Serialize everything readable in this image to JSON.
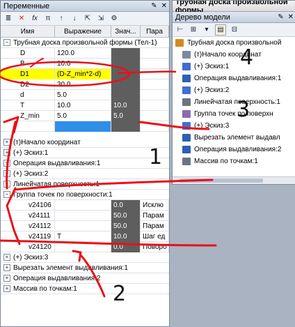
{
  "left_panel": {
    "title": "Переменные",
    "toolbar_icons": [
      "list-icon",
      "delete-icon",
      "function-icon",
      "pi-icon",
      "move-up-icon",
      "move-down-icon",
      "export-icon",
      "import-icon",
      "settings-icon"
    ],
    "columns": [
      "Имя",
      "Выражение",
      "Знач...",
      "Пара"
    ],
    "group_main": "Трубная доска произвольной формы (Тел-1)",
    "variables": [
      {
        "name": "D",
        "expr": "120.0",
        "value": "",
        "param": ""
      },
      {
        "name": "B",
        "expr": "10.0",
        "value": "",
        "param": ""
      },
      {
        "name": "D1",
        "expr": "(D-Z_min*2-d)",
        "value": "",
        "param": ""
      },
      {
        "name": "D2",
        "expr": "30.0",
        "value": "",
        "param": ""
      },
      {
        "name": "d",
        "expr": "5.0",
        "value": "",
        "param": ""
      },
      {
        "name": "T",
        "expr": "10.0",
        "value": "10.0",
        "param": ""
      },
      {
        "name": "Z_min",
        "expr": "5.0",
        "value": "5.0",
        "param": ""
      }
    ],
    "groups": [
      {
        "label": "(т)Начало координат",
        "expanded": false
      },
      {
        "label": "(+) Эскиз:1",
        "expanded": false
      },
      {
        "label": "Операция выдавливания:1",
        "expanded": false
      },
      {
        "label": "(+) Эскиз:2",
        "expanded": false
      },
      {
        "label": "Линейчатая поверхность:1",
        "expanded": false
      },
      {
        "label": "Группа точек по поверхности:1",
        "expanded": true
      }
    ],
    "sub_variables": [
      {
        "name": "v24106",
        "expr": "",
        "value": "0.0",
        "param": "Исклю"
      },
      {
        "name": "v24111",
        "expr": "",
        "value": "50.0",
        "param": "Парам"
      },
      {
        "name": "v24112",
        "expr": "",
        "value": "50.0",
        "param": "Парам"
      },
      {
        "name": "v24119",
        "expr": "T",
        "value": "10.0",
        "param": "Шаг ед"
      },
      {
        "name": "v24120",
        "expr": "",
        "value": "0.0",
        "param": "Поворо"
      }
    ],
    "groups_after": [
      {
        "label": "(+) Эскиз:3"
      },
      {
        "label": "Вырезать элемент выдавливания:1"
      },
      {
        "label": "Операция выдавливания:2"
      },
      {
        "label": "Массив по точкам:1"
      }
    ]
  },
  "right_panel": {
    "window_title": "Трубная доска произвольной формы",
    "title": "Дерево модели",
    "tree": [
      {
        "label": "Трубная доска произвольной",
        "icon": "part-icon",
        "color": "#d48a1a"
      },
      {
        "label": "(т)Начало координат",
        "icon": "origin-icon",
        "color": "#7b8aa0"
      },
      {
        "label": "(+) Эскиз:1",
        "icon": "sketch-icon",
        "color": "#3f6fd0"
      },
      {
        "label": "Операция выдавливания:1",
        "icon": "extrude-icon",
        "color": "#2d5fb5"
      },
      {
        "label": "(+) Эскиз:2",
        "icon": "sketch-icon",
        "color": "#3f6fd0"
      },
      {
        "label": "Линейчатая поверхность:1",
        "icon": "surface-icon",
        "color": "#6c7480"
      },
      {
        "label": "Группа точек по поверхн",
        "icon": "points-icon",
        "color": "#8a6ab0"
      },
      {
        "label": "(+) Эскиз:3",
        "icon": "sketch-icon",
        "color": "#3f6fd0"
      },
      {
        "label": "Вырезать элемент выдавл",
        "icon": "cut-icon",
        "color": "#2d5fb5"
      },
      {
        "label": "Операция выдавливания:2",
        "icon": "extrude-icon",
        "color": "#2d5fb5"
      },
      {
        "label": "Массив по точкам:1",
        "icon": "array-icon",
        "color": "#6c7480"
      }
    ]
  },
  "annotations": {
    "n1": "1",
    "n2": "2",
    "n3": "3",
    "n4": "4",
    "color": "#e8101a"
  }
}
